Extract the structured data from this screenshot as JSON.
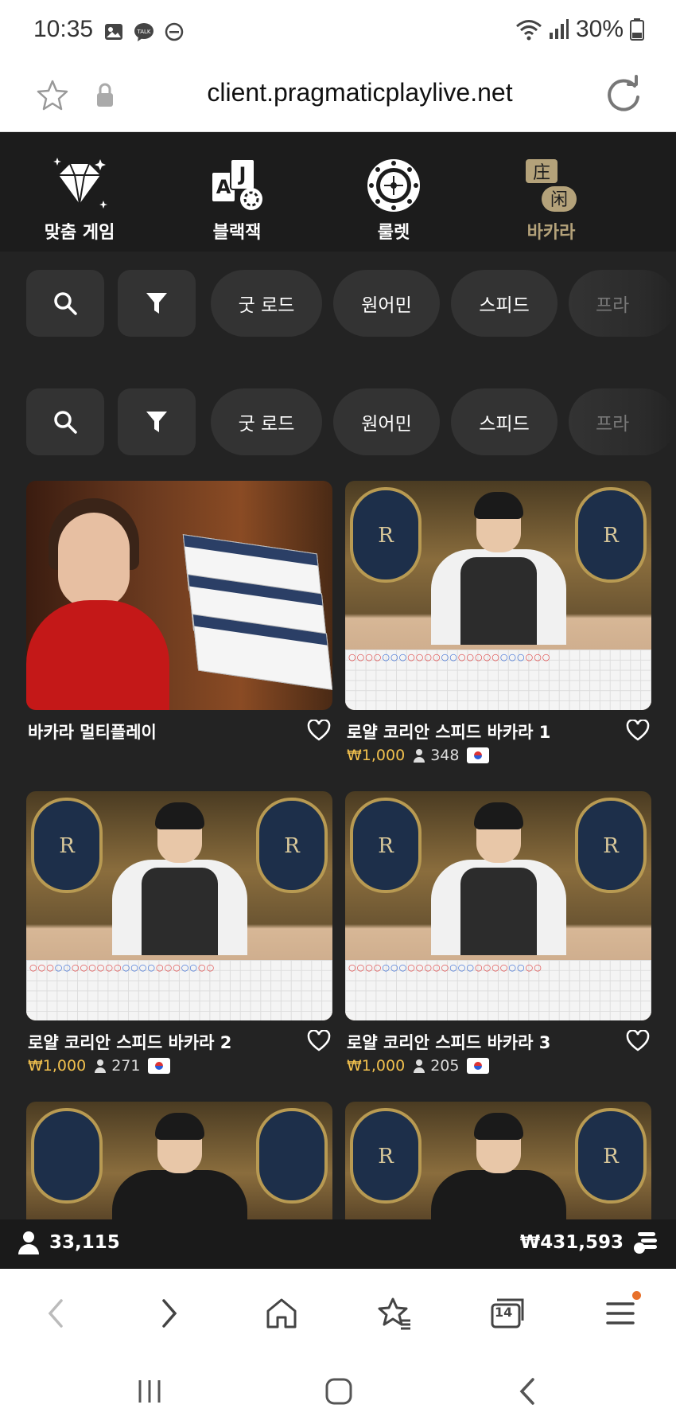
{
  "status_bar": {
    "time": "10:35",
    "battery": "30%",
    "icons": [
      "gallery-icon",
      "talk-icon",
      "dnd-icon",
      "wifi-icon",
      "signal-icon",
      "battery-icon"
    ]
  },
  "browser": {
    "url": "client.pragmaticplaylive.net",
    "tab_count": "14"
  },
  "categories": [
    {
      "label": "맞춤 게임",
      "icon": "diamond-icon"
    },
    {
      "label": "블랙잭",
      "icon": "cards-icon"
    },
    {
      "label": "룰렛",
      "icon": "roulette-icon"
    },
    {
      "label": "바카라",
      "icon": "baccarat-icon",
      "active": true
    }
  ],
  "filters": {
    "pills": [
      "굿 로드",
      "원어민",
      "스피드",
      "프라"
    ]
  },
  "games": [
    {
      "title": "바카라 멀티플레이",
      "bet": "",
      "players": ""
    },
    {
      "title": "로얄 코리안 스피드 바카라 1",
      "bet": "₩1,000",
      "players": "348"
    },
    {
      "title": "로얄 코리안 스피드 바카라 2",
      "bet": "₩1,000",
      "players": "271"
    },
    {
      "title": "로얄 코리안 스피드 바카라 3",
      "bet": "₩1,000",
      "players": "205"
    }
  ],
  "stats": {
    "online_players": "33,115",
    "balance": "₩431,593"
  },
  "colors": {
    "accent_gold": "#f2c14e",
    "background": "#232323",
    "active_category": "#b4a27a"
  }
}
